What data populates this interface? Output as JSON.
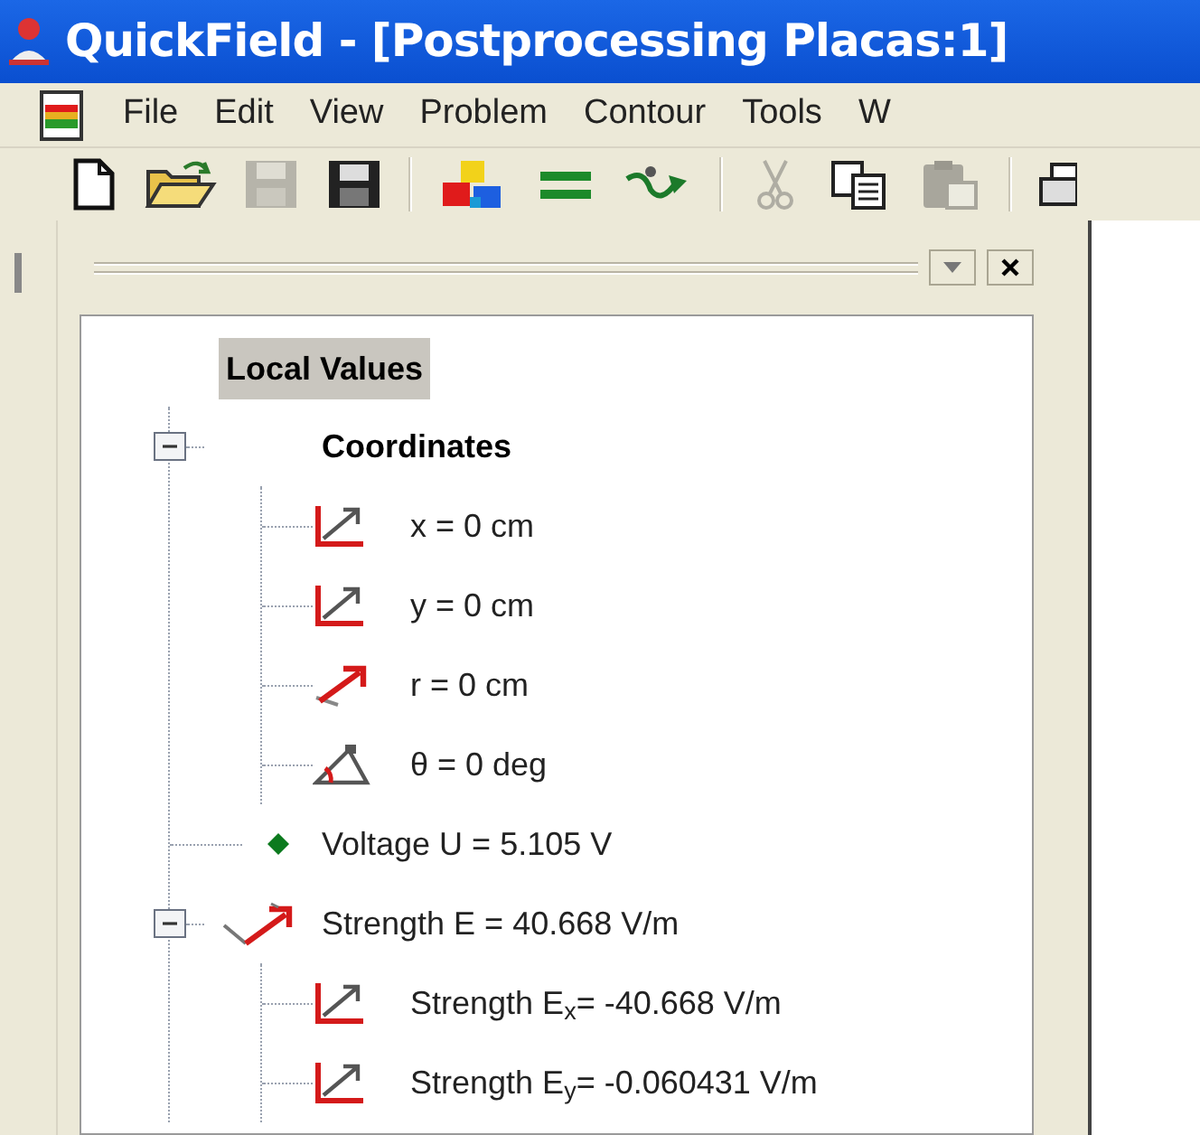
{
  "window": {
    "title": "QuickField - [Postprocessing Placas:1]"
  },
  "menu": [
    "File",
    "Edit",
    "View",
    "Problem",
    "Contour",
    "Tools",
    "W"
  ],
  "toolbar": [
    {
      "kind": "new",
      "disabled": false
    },
    {
      "kind": "open",
      "disabled": false
    },
    {
      "kind": "save",
      "disabled": true
    },
    {
      "kind": "save-all",
      "disabled": false
    },
    {
      "kind": "separator"
    },
    {
      "kind": "blocks",
      "disabled": false
    },
    {
      "kind": "equals",
      "disabled": false
    },
    {
      "kind": "connect",
      "disabled": false
    },
    {
      "kind": "separator"
    },
    {
      "kind": "cut",
      "disabled": true
    },
    {
      "kind": "copy",
      "disabled": false
    },
    {
      "kind": "paste",
      "disabled": true
    },
    {
      "kind": "separator"
    },
    {
      "kind": "print",
      "disabled": false
    }
  ],
  "tree": {
    "label": "Local Values",
    "selected": true,
    "children": [
      {
        "label": "Coordinates",
        "kind": "group",
        "selected": false,
        "expanded": true,
        "children": [
          {
            "label": "x = 0 cm",
            "kind": "axes",
            "selected": false
          },
          {
            "label": "y = 0 cm",
            "kind": "axes",
            "selected": false
          },
          {
            "label": "r = 0 cm",
            "kind": "radius",
            "selected": false
          },
          {
            "label": "θ = 0 deg",
            "kind": "angle",
            "selected": false
          }
        ]
      },
      {
        "label": "Voltage U = 5.105 V",
        "kind": "dot",
        "selected": false
      },
      {
        "label": "Strength E = 40.668 V/m",
        "kind": "vector",
        "selected": false,
        "expanded": true,
        "children": [
          {
            "label": "Strength E$_{x}$= -40.668 V/m",
            "kind": "axes",
            "selected": false
          },
          {
            "label": "Strength E$_{y}$= -0.060431 V/m",
            "kind": "axes",
            "selected": false
          }
        ]
      }
    ]
  }
}
